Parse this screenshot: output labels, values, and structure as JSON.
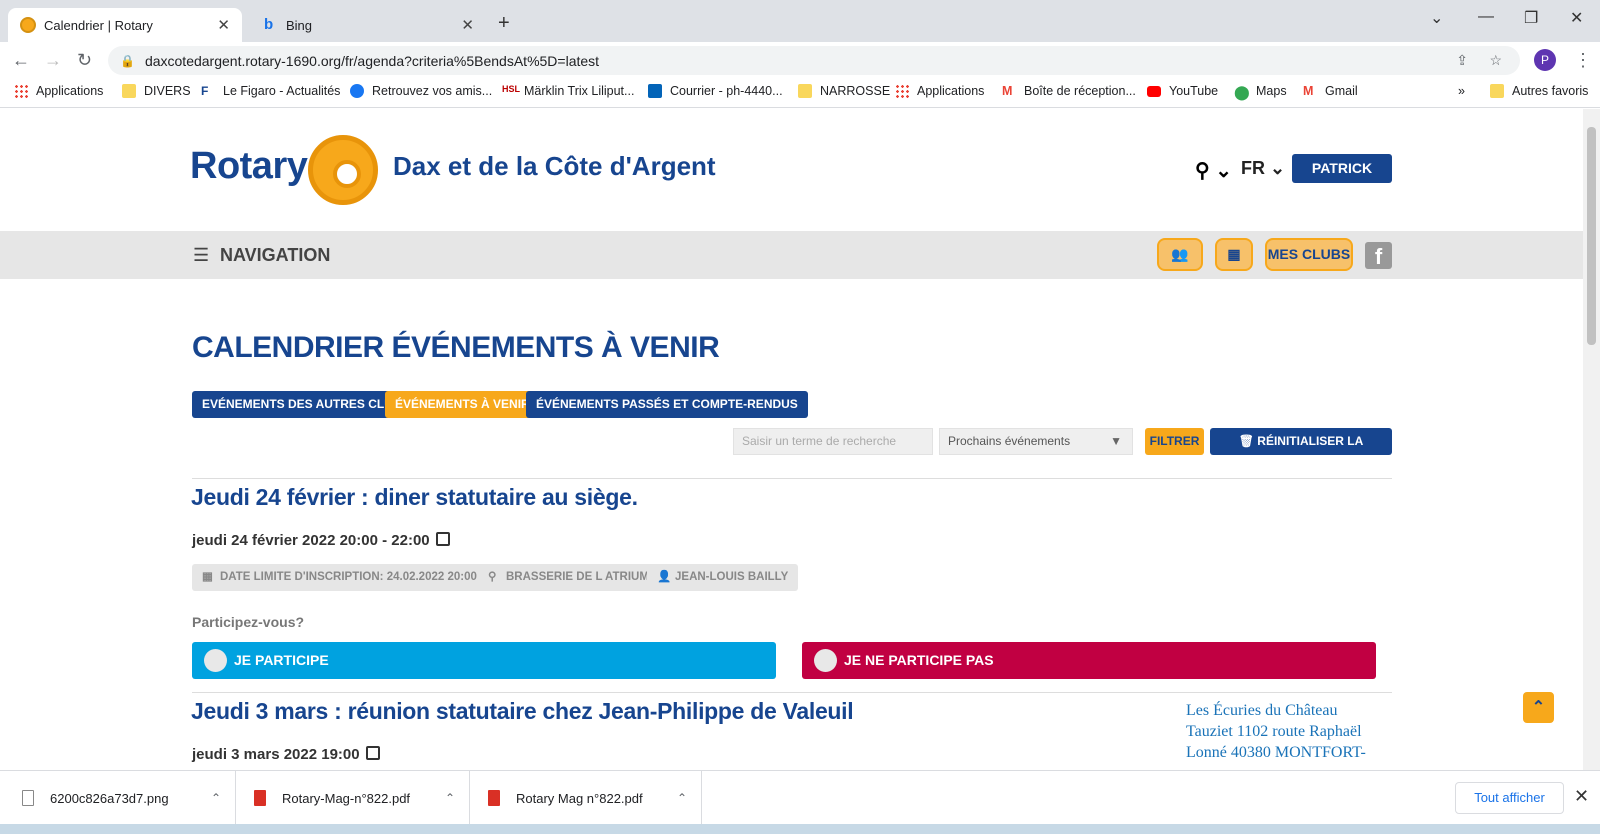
{
  "browser": {
    "tabs": [
      {
        "title": "Calendrier | Rotary",
        "active": true
      },
      {
        "title": "Bing",
        "active": false
      }
    ],
    "url": "daxcotedargent.rotary-1690.org/fr/agenda?criteria%5BendsAt%5D=latest",
    "profile_initial": "P",
    "bookmarks": [
      "Applications",
      "DIVERS",
      "Le Figaro - Actualités",
      "Retrouvez vos amis...",
      "Märklin Trix Liliput...",
      "Courrier - ph-4440...",
      "NARROSSE",
      "Applications",
      "Boîte de réception...",
      "YouTube",
      "Maps",
      "Gmail"
    ],
    "other_bookmarks": "Autres favoris",
    "more_bookmarks": "»"
  },
  "site": {
    "logo_word": "Rotary",
    "club_title": "Dax et de la Côte d'Argent",
    "lang": "FR",
    "user": "PATRICK HAYE",
    "nav_label": "NAVIGATION",
    "my_clubs": "MES CLUBS",
    "facebook": "f"
  },
  "main": {
    "heading": "CALENDRIER ÉVÉNEMENTS À VENIR",
    "tabs": [
      {
        "label": "EVÉNEMENTS DES AUTRES CLUBS",
        "style": "blue"
      },
      {
        "label": "ÉVÉNEMENTS À VENIR",
        "style": "gold"
      },
      {
        "label": "ÉVÉNEMENTS PASSÉS ET COMPTE-RENDUS",
        "style": "blue"
      }
    ],
    "search_placeholder": "Saisir un terme de recherche",
    "select_value": "Prochains événements",
    "filter_label": "FILTRER",
    "reset_label": "RÉINITIALISER LA RECHERCHE",
    "events": [
      {
        "title": "Jeudi 24 février : diner statutaire au siège.",
        "date": "jeudi 24 février 2022 20:00 - 22:00",
        "tags": [
          "DATE LIMITE D'INSCRIPTION: 24.02.2022 20:00",
          "BRASSERIE DE L ATRIUM",
          "JEAN-LOUIS BAILLY"
        ],
        "question": "Participez-vous?",
        "yes": "JE PARTICIPE",
        "no": "JE NE PARTICIPE PAS"
      },
      {
        "title": "Jeudi 3 mars : réunion statutaire chez Jean-Philippe de Valeuil",
        "date": "jeudi 3 mars 2022 19:00",
        "image_alt": "Les Écuries du Château Tauziet 1102 route Raphaël Lonné 40380 MONTFORT-"
      }
    ]
  },
  "downloads": {
    "items": [
      "6200c826a73d7.png",
      "Rotary-Mag-n°822.pdf",
      "Rotary Mag n°822.pdf"
    ],
    "show_all": "Tout afficher"
  },
  "colors": {
    "rotary_blue": "#17458f",
    "rotary_gold": "#f7a81b",
    "participate": "#00a2e0",
    "decline": "#c10042"
  }
}
